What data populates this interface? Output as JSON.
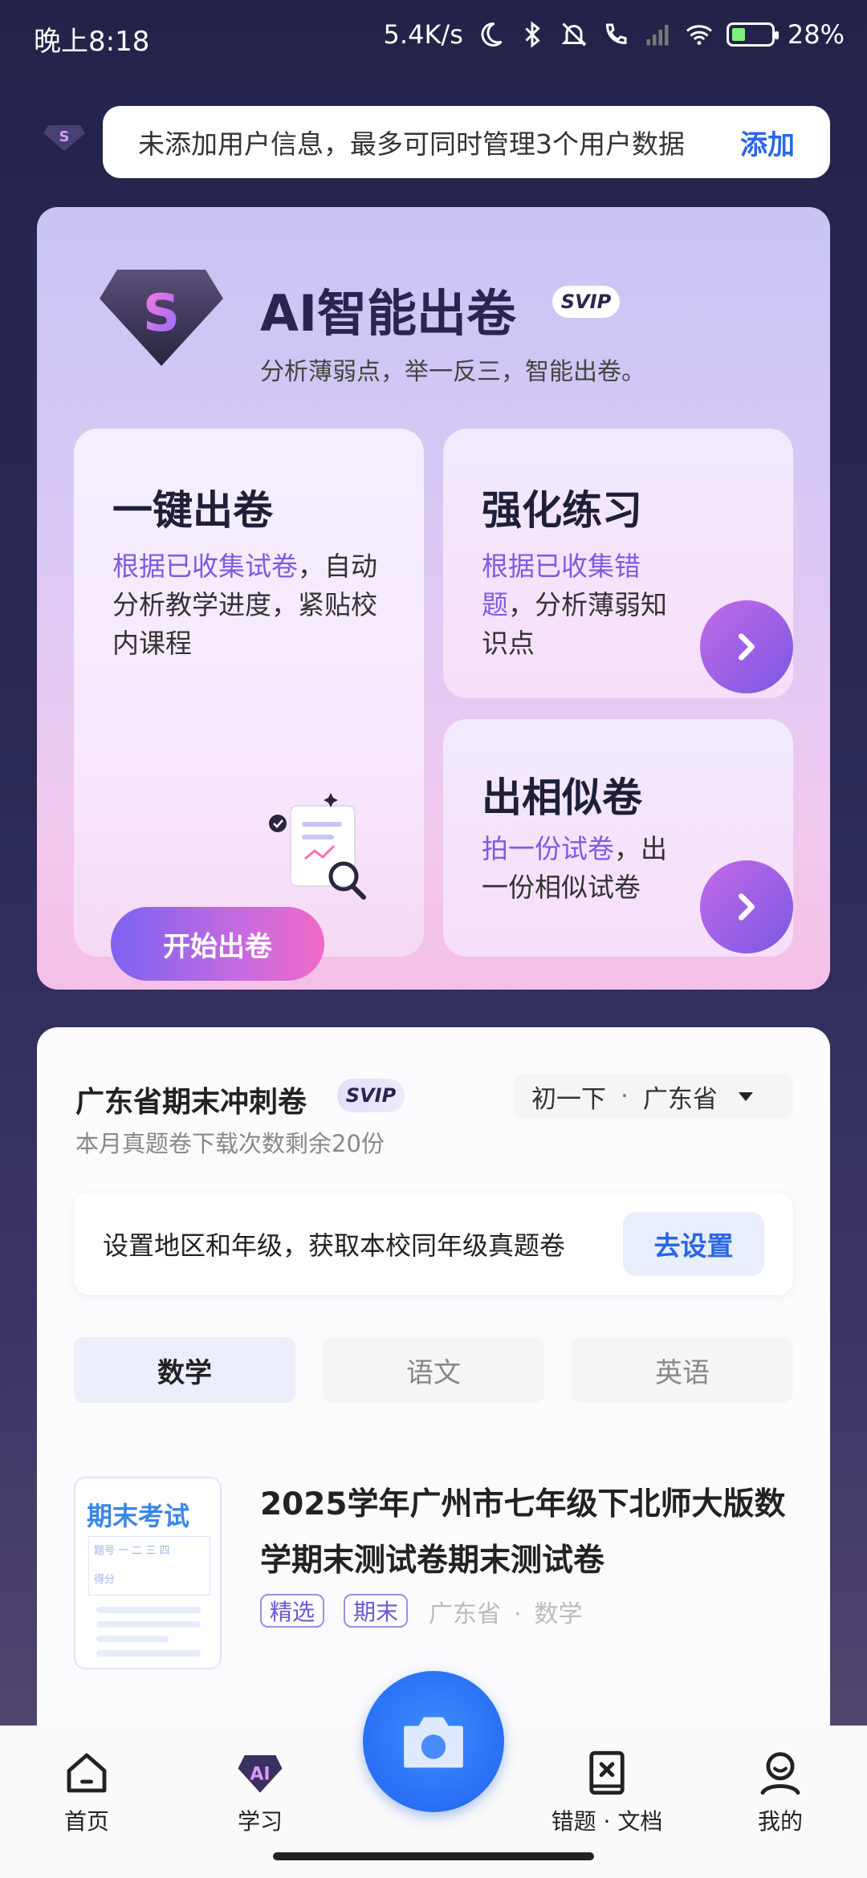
{
  "status_bar": {
    "time": "晚上8:18",
    "network_speed": "5.4K/s",
    "battery": "28%"
  },
  "notice": {
    "text": "未添加用户信息，最多可同时管理3个用户数据",
    "action": "添加"
  },
  "ai_card": {
    "title": "AI智能出卷",
    "badge": "SVIP",
    "subtitle": "分析薄弱点，举一反三，智能出卷。",
    "one_click": {
      "title": "一键出卷",
      "desc_highlight": "根据已收集试卷",
      "desc_rest": "，自动分析教学进度，紧贴校内课程",
      "button": "开始出卷"
    },
    "practice": {
      "title": "强化练习",
      "desc_highlight": "根据已收集错题",
      "desc_rest": "，分析薄弱知识点"
    },
    "similar": {
      "title": "出相似卷",
      "desc_highlight": "拍一份试卷",
      "desc_rest": "，出一份相似试卷"
    }
  },
  "exam": {
    "title": "广东省期末冲刺卷",
    "badge": "SVIP",
    "subtitle": "本月真题卷下载次数剩余20份",
    "grade": "初一下",
    "province": "广东省",
    "setting_text": "设置地区和年级，获取本校同年级真题卷",
    "setting_button": "去设置",
    "tabs": [
      "数学",
      "语文",
      "英语"
    ],
    "item": {
      "thumb_title": "期末考试",
      "thumb_header": "题号 一 二 三 四",
      "thumb_score": "得分",
      "title": "2025学年广州市七年级下北师大版数学期末测试卷期末测试卷",
      "tags": [
        "精选",
        "期末"
      ],
      "meta_province": "广东省",
      "meta_subject": "数学"
    }
  },
  "nav": {
    "home": "首页",
    "study": "学习",
    "mistakes": "错题 · 文档",
    "me": "我的"
  }
}
